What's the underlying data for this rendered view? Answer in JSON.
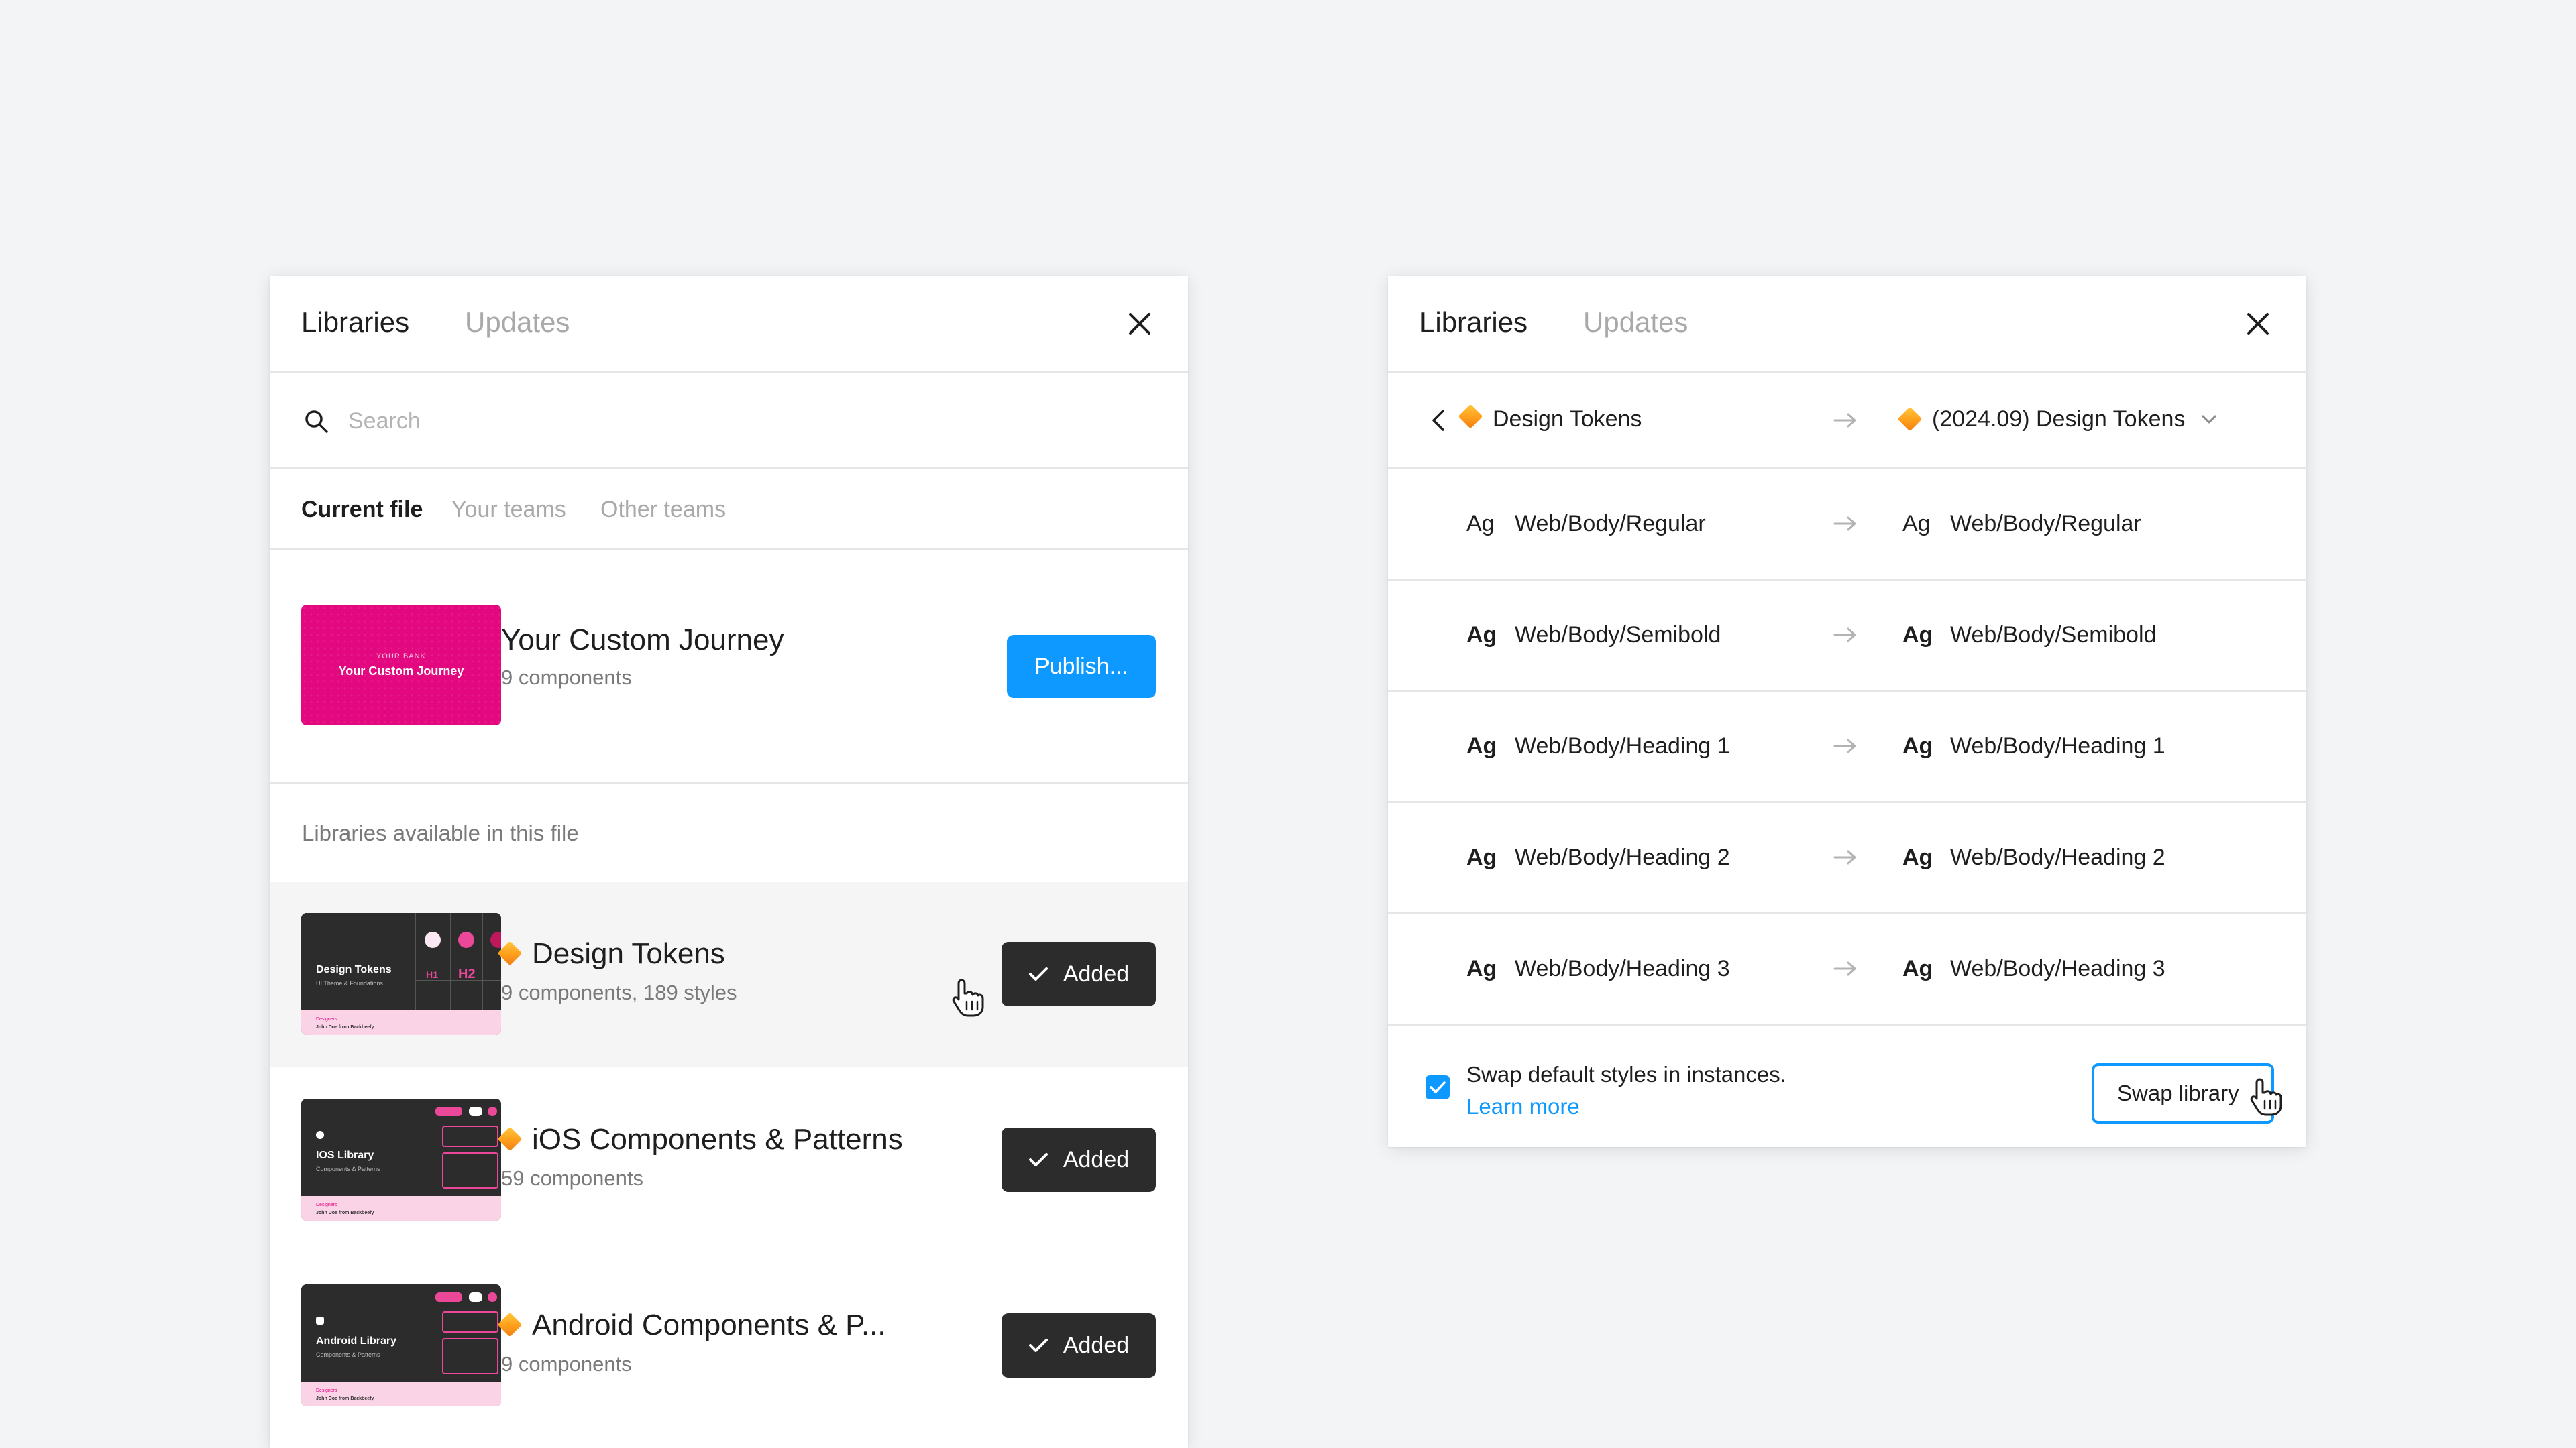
{
  "left_panel": {
    "tabs": {
      "libraries": "Libraries",
      "updates": "Updates"
    },
    "search": {
      "placeholder": "Search"
    },
    "filter_tabs": {
      "current_file": "Current file",
      "your_teams": "Your teams",
      "other_teams": "Other teams"
    },
    "current_library": {
      "thumb_small": "YOUR BANK",
      "thumb_big": "Your Custom Journey",
      "title": "Your Custom Journey",
      "subtitle": "9 components",
      "publish_label": "Publish..."
    },
    "section_label": "Libraries available in this file",
    "libraries": [
      {
        "title": "Design Tokens",
        "subtitle": "9 components, 189 styles",
        "thumb_title": "Design Tokens",
        "thumb_sub": "UI Theme & Foundations",
        "thumb_h1": "H1",
        "thumb_h2": "H2",
        "button_label": "Added"
      },
      {
        "title": "iOS Components & Patterns",
        "subtitle": "59 components",
        "thumb_title": "IOS Library",
        "thumb_sub": "Components & Patterns",
        "button_label": "Added"
      },
      {
        "title": "Android Components & P...",
        "subtitle": "9 components",
        "thumb_title": "Android Library",
        "thumb_sub": "Components & Patterns",
        "button_label": "Added"
      }
    ],
    "thumb_footer_line1": "Designers",
    "thumb_footer_line2": "John Doe from Backbeefy"
  },
  "right_panel": {
    "tabs": {
      "libraries": "Libraries",
      "updates": "Updates"
    },
    "from_library": "Design Tokens",
    "to_library": "(2024.09) Design Tokens",
    "ag_label": "Ag",
    "styles": [
      {
        "from": "Web/Body/Regular",
        "to": "Web/Body/Regular",
        "weight": "regular"
      },
      {
        "from": "Web/Body/Semibold",
        "to": "Web/Body/Semibold",
        "weight": "bold"
      },
      {
        "from": "Web/Body/Heading 1",
        "to": "Web/Body/Heading 1",
        "weight": "bold"
      },
      {
        "from": "Web/Body/Heading 2",
        "to": "Web/Body/Heading 2",
        "weight": "bold"
      },
      {
        "from": "Web/Body/Heading 3",
        "to": "Web/Body/Heading 3",
        "weight": "bold"
      }
    ],
    "swap_default_label": "Swap default styles in instances.",
    "learn_more": "Learn more",
    "swap_button": "Swap library"
  },
  "colors": {
    "accent_blue": "#0d99ff",
    "brand_pink": "#e3087f",
    "dark_button": "#2c2c2c",
    "background": "#f2f4f6"
  }
}
